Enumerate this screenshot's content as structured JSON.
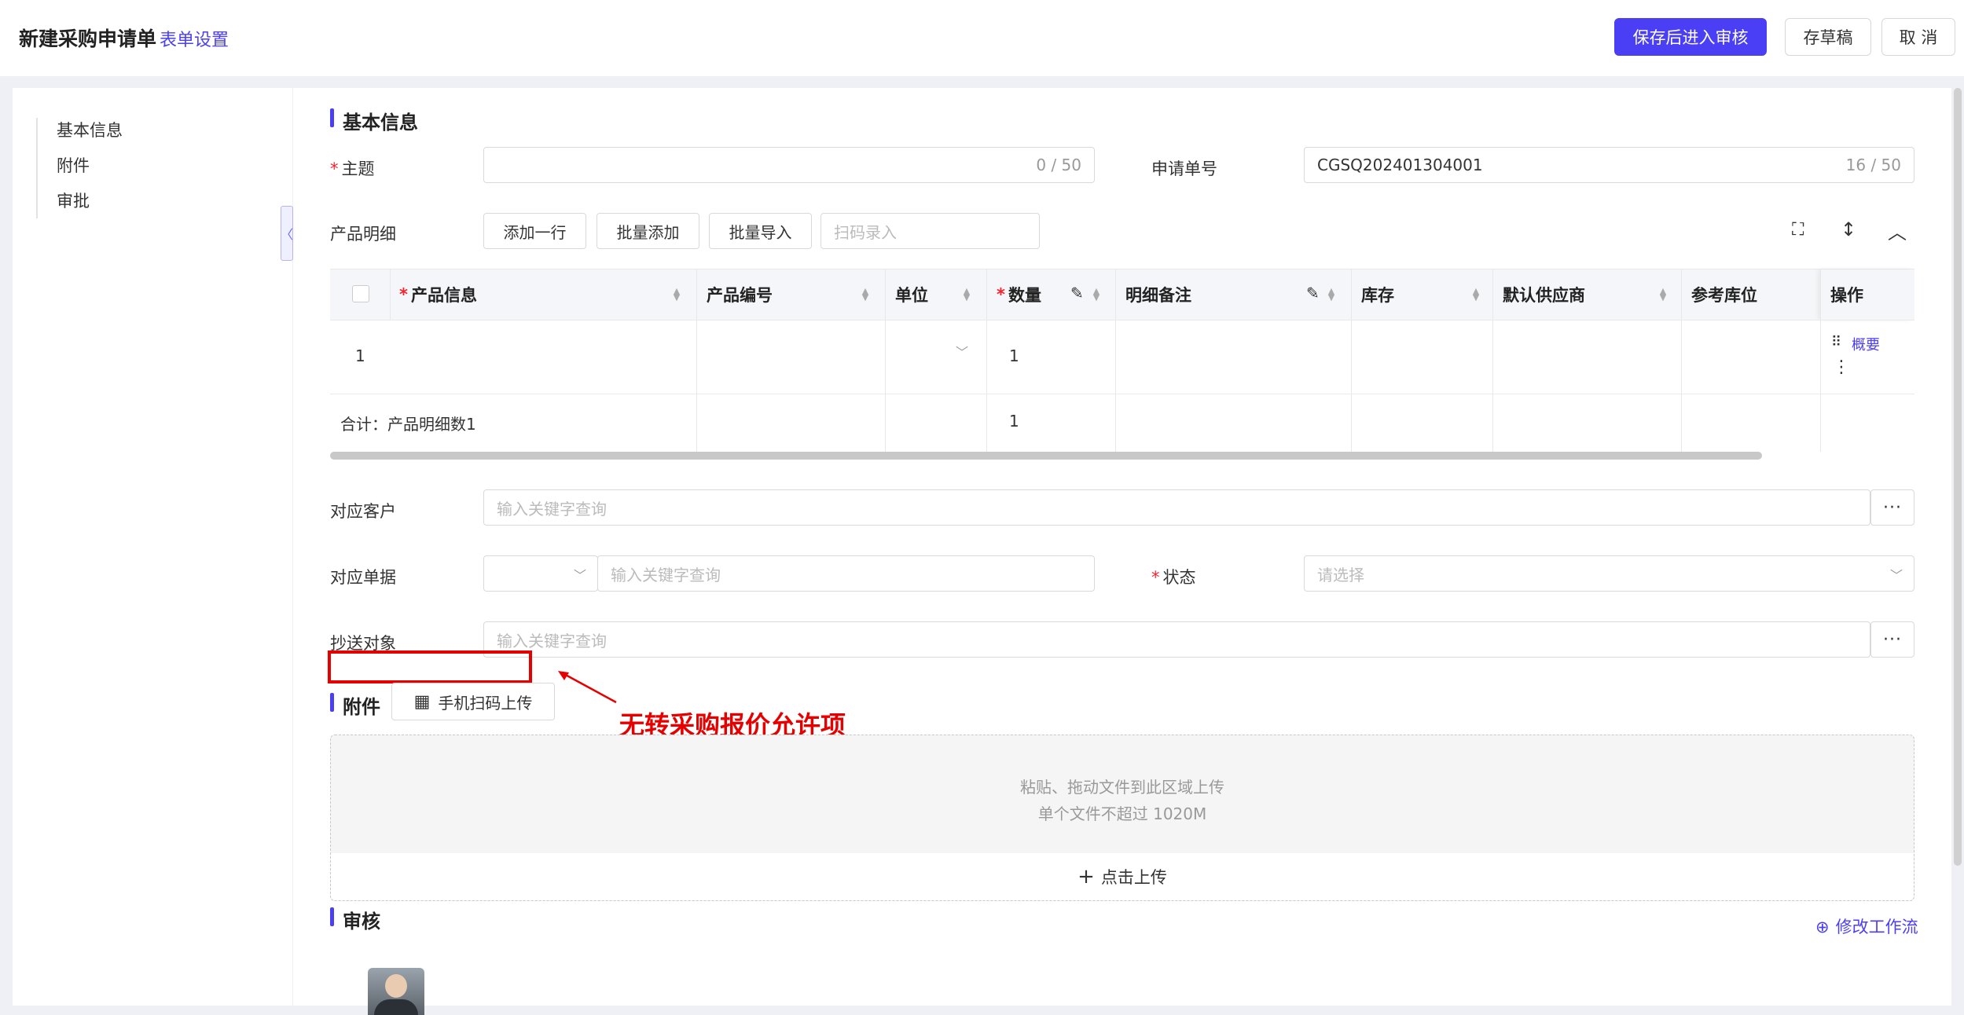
{
  "header": {
    "title": "新建采购申请单",
    "form_settings": "表单设置",
    "save_review": "保存后进入审核",
    "draft": "存草稿",
    "cancel": "取 消"
  },
  "sidebar": {
    "items": [
      {
        "label": "基本信息"
      },
      {
        "label": "附件"
      },
      {
        "label": "审批"
      }
    ]
  },
  "basic": {
    "title": "基本信息",
    "subject_label": "主题",
    "subject_counter": "0 / 50",
    "order_no_label": "申请单号",
    "order_no_value": "CGSQ202401304001",
    "order_no_counter": "16 / 50"
  },
  "products": {
    "label": "产品明细",
    "add_row": "添加一行",
    "batch_add": "批量添加",
    "batch_import": "批量导入",
    "scan_placeholder": "扫码录入",
    "columns": [
      "产品信息",
      "产品编号",
      "单位",
      "数量",
      "明细备注",
      "库存",
      "默认供应商",
      "参考库位",
      "操作"
    ],
    "row_index": "1",
    "row_qty": "1",
    "row_action": "概要",
    "total_label": "合计：产品明细数1",
    "total_qty": "1"
  },
  "fields": {
    "customer_label": "对应客户",
    "customer_placeholder": "输入关键字查询",
    "doc_label": "对应单据",
    "doc_placeholder": "输入关键字查询",
    "status_label": "状态",
    "status_placeholder": "请选择",
    "cc_label": "抄送对象",
    "cc_placeholder": "输入关键字查询"
  },
  "attachment": {
    "title": "附件",
    "mobile_upload": "手机扫码上传",
    "drop_line1": "粘贴、拖动文件到此区域上传",
    "drop_line2": "单个文件不超过 1020M",
    "click_upload": "点击上传"
  },
  "review": {
    "title": "审核",
    "modify_workflow": "修改工作流"
  },
  "annotation": {
    "text": "无转采购报价允许项"
  },
  "colors": {
    "accent": "#4b3ff5",
    "annotation": "#e60000"
  }
}
